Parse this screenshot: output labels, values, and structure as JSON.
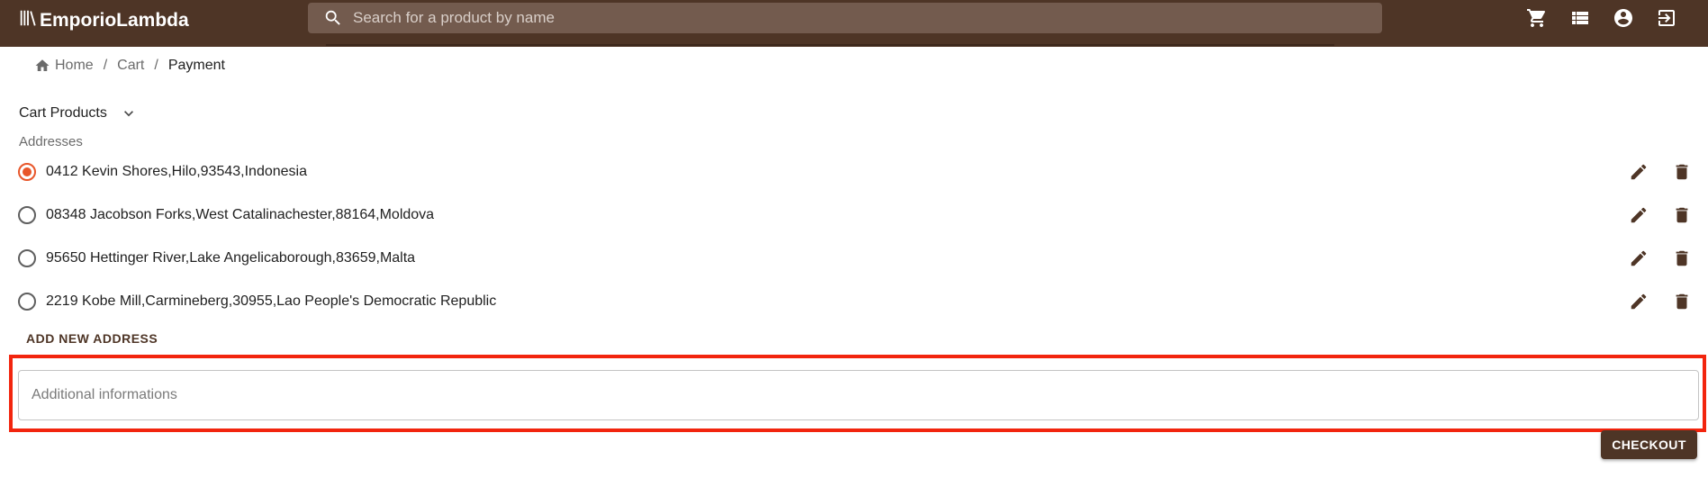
{
  "app": {
    "brand": "EmporioLambda",
    "search_placeholder": "Search for a product by name",
    "icons": [
      "cart-icon",
      "list-icon",
      "account-circle-icon",
      "logout-icon"
    ]
  },
  "breadcrumb": {
    "home": "Home",
    "cart": "Cart",
    "current": "Payment",
    "separator": "/"
  },
  "cart_products": {
    "label": "Cart Products"
  },
  "addresses": {
    "label": "Addresses",
    "items": [
      {
        "text": "0412 Kevin Shores,Hilo,93543,Indonesia",
        "selected": true
      },
      {
        "text": "08348 Jacobson Forks,West Catalinachester,88164,Moldova",
        "selected": false
      },
      {
        "text": "95650 Hettinger River,Lake Angelicaborough,83659,Malta",
        "selected": false
      },
      {
        "text": "2219 Kobe Mill,Carmineberg,30955,Lao People's Democratic Republic",
        "selected": false
      }
    ],
    "add_label": "ADD NEW ADDRESS"
  },
  "additional_info": {
    "placeholder": "Additional informations",
    "value": ""
  },
  "checkout": {
    "label": "CHECKOUT"
  },
  "colors": {
    "primary": "#4e3526",
    "search_bg": "#735b4e",
    "accent": "#e8562a",
    "highlight": "#f2250e"
  }
}
